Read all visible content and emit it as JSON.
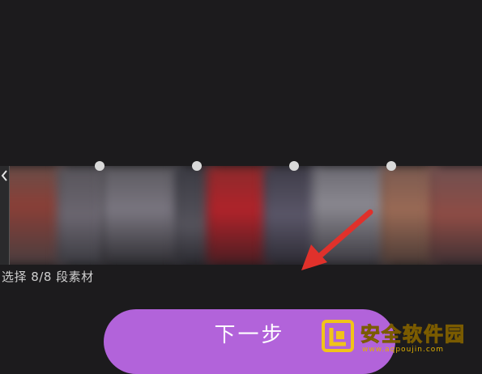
{
  "selection": {
    "text": "选择 8/8 段素材"
  },
  "next_button": {
    "label": "下一步"
  },
  "watermark": {
    "title": "安全软件园",
    "url": "www.aqpoujin.com",
    "color": "#f0c419"
  },
  "colors": {
    "background": "#1c1b1d",
    "button": "#b263da",
    "arrow": "#e0312b"
  },
  "icons": {
    "trim_handle": "chevron-left-icon",
    "annotation": "arrow-icon"
  }
}
